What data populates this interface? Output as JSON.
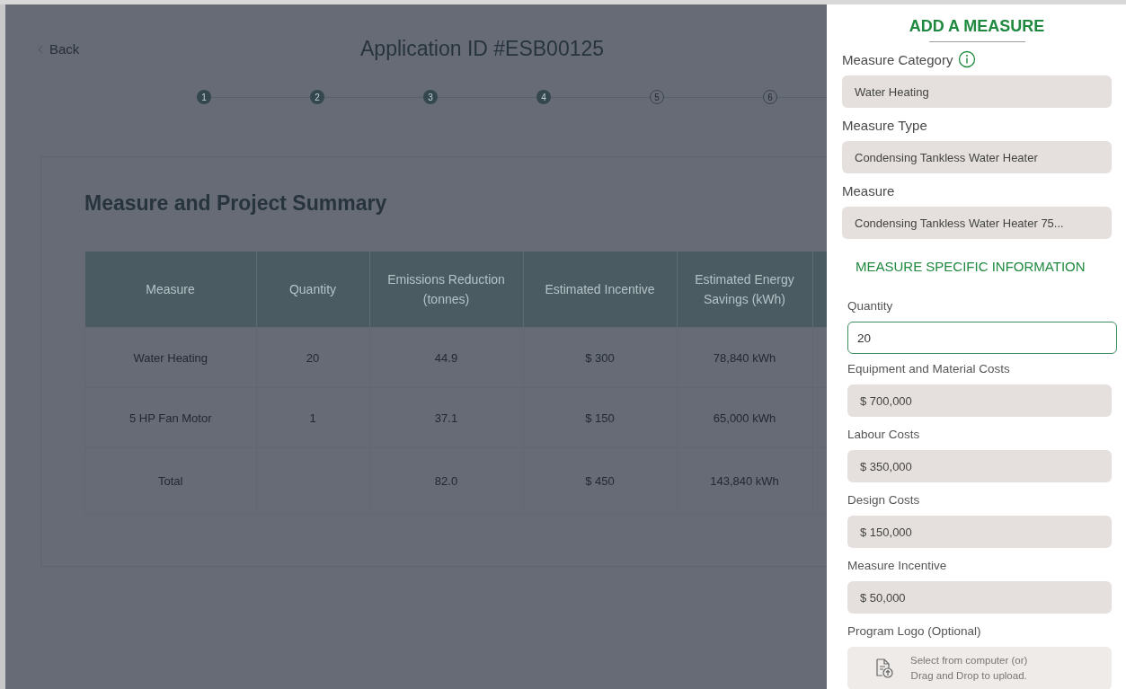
{
  "back": {
    "label": "Back"
  },
  "title": "Application ID #ESB00125",
  "steps": [
    {
      "label": "1",
      "completed": true
    },
    {
      "label": "2",
      "completed": true
    },
    {
      "label": "3",
      "completed": true
    },
    {
      "label": "4",
      "completed": true
    },
    {
      "label": "5",
      "completed": false
    },
    {
      "label": "6",
      "completed": false
    }
  ],
  "summary": {
    "title": "Measure and Project Summary",
    "columns": [
      "Measure",
      "Quantity",
      "Emissions Reduction (tonnes)",
      "Estimated Incentive",
      "Estimated Energy Savings (kWh)"
    ],
    "rows": [
      [
        "Water Heating",
        "20",
        "44.9",
        "$ 300",
        "78,840 kWh"
      ],
      [
        "5 HP Fan Motor",
        "1",
        "37.1",
        "$ 150",
        "65,000 kWh"
      ],
      [
        "Total",
        null,
        "82.0",
        "$ 450",
        "143,840 kWh"
      ]
    ]
  },
  "drawer": {
    "title": "ADD A MEASURE",
    "items": [
      {
        "kind": "select",
        "label": "Measure Category",
        "info": true,
        "value": "Water Heating"
      },
      {
        "kind": "select",
        "label": "Measure Type",
        "value": "Condensing Tankless Water Heater"
      },
      {
        "kind": "select",
        "label": "Measure",
        "value": "Condensing Tankless Water Heater 75..."
      },
      {
        "kind": "heading",
        "text": "MEASURE SPECIFIC INFORMATION"
      },
      {
        "kind": "input",
        "label": "Quantity",
        "value": "20"
      },
      {
        "kind": "amount",
        "label": "Equipment and Material Costs",
        "value": "$ 700,000"
      },
      {
        "kind": "amount",
        "label": "Labour Costs",
        "value": "$ 350,000"
      },
      {
        "kind": "amount",
        "label": "Design Costs",
        "value": "$ 150,000"
      },
      {
        "kind": "amount",
        "label": "Measure Incentive",
        "value": "$ 50,000"
      },
      {
        "kind": "upload",
        "label": "Program Logo (Optional)",
        "lines": [
          "Select from computer (or)",
          "Drag and Drop to upload."
        ]
      }
    ]
  }
}
